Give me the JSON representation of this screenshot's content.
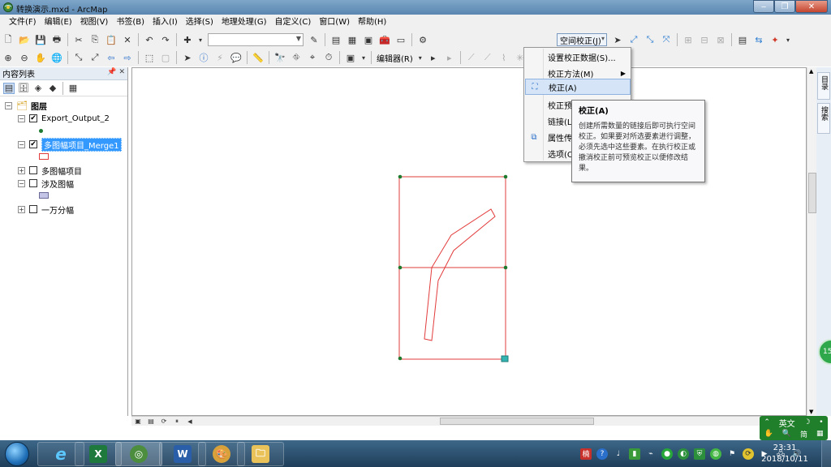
{
  "window": {
    "title": "转换演示.mxd - ArcMap"
  },
  "menubar": [
    "文件(F)",
    "编辑(E)",
    "视图(V)",
    "书签(B)",
    "插入(I)",
    "选择(S)",
    "地理处理(G)",
    "自定义(C)",
    "窗口(W)",
    "帮助(H)"
  ],
  "toolbar": {
    "spatial_adjust_label": "空间校正(J)",
    "editor_label": "编辑器(R)"
  },
  "toc": {
    "title": "内容列表",
    "root_label": "图层",
    "layers": [
      {
        "label": "Export_Output_2",
        "checked": true,
        "expanded": true
      },
      {
        "label": "多图幅项目_Merge1",
        "checked": true,
        "expanded": true,
        "selected": true
      },
      {
        "label": "多图幅项目",
        "checked": false,
        "expanded": false
      },
      {
        "label": "涉及图幅",
        "checked": false,
        "expanded": true
      },
      {
        "label": "一万分幅",
        "checked": false,
        "expanded": false
      }
    ]
  },
  "dropdown": {
    "items": [
      {
        "label": "设置校正数据(S)..."
      },
      {
        "label": "校正方法(M)",
        "submenu": true
      },
      {
        "label": "校正(A)",
        "highlighted": true
      },
      {
        "label": "校正预"
      },
      {
        "label": "链接(L)"
      },
      {
        "label": "属性传"
      },
      {
        "label": "选项(O"
      }
    ]
  },
  "tooltip": {
    "title": "校正(A)",
    "body": "创建所需数量的链接后即可执行空间校正。如果要对所选要素进行调整，必须先选中这些要素。在执行校正或撤消校正前可预览校正以便修改结果。"
  },
  "sidetabs": [
    "目录",
    "搜索"
  ],
  "ime": {
    "lang": "英文"
  },
  "green_bubble": "15",
  "clock": {
    "time": "23:31",
    "date": "2018/10/11"
  },
  "colors": {
    "feature_stroke": "#e23b3b",
    "vertex": "#1d7a2e",
    "taskbar": "#1f3e5a",
    "highlight": "#d5e5f7"
  }
}
